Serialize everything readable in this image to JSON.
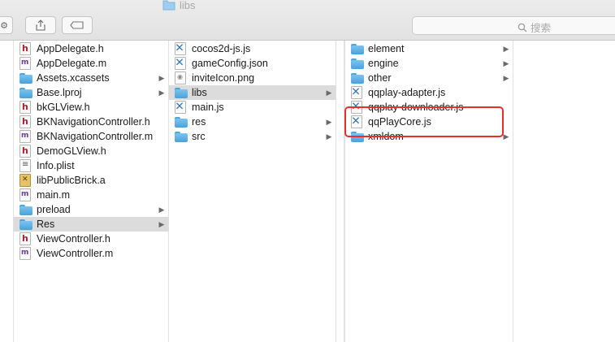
{
  "window": {
    "title": "libs"
  },
  "search": {
    "placeholder": "搜索"
  },
  "col1": [
    {
      "label": "AppDelegate.h",
      "icon": "h-file-icon",
      "folder": false,
      "selected": false
    },
    {
      "label": "AppDelegate.m",
      "icon": "m-file-icon",
      "folder": false,
      "selected": false
    },
    {
      "label": "Assets.xcassets",
      "icon": "folder-icon",
      "folder": true,
      "selected": false
    },
    {
      "label": "Base.lproj",
      "icon": "folder-icon",
      "folder": true,
      "selected": false
    },
    {
      "label": "bkGLView.h",
      "icon": "h-file-icon",
      "folder": false,
      "selected": false
    },
    {
      "label": "BKNavigationController.h",
      "icon": "h-file-icon",
      "folder": false,
      "selected": false
    },
    {
      "label": "BKNavigationController.m",
      "icon": "m-file-icon",
      "folder": false,
      "selected": false
    },
    {
      "label": "DemoGLView.h",
      "icon": "h-file-icon",
      "folder": false,
      "selected": false
    },
    {
      "label": "Info.plist",
      "icon": "plist-file-icon",
      "folder": false,
      "selected": false
    },
    {
      "label": "libPublicBrick.a",
      "icon": "archive-file-icon",
      "folder": false,
      "selected": false
    },
    {
      "label": "main.m",
      "icon": "m-file-icon",
      "folder": false,
      "selected": false
    },
    {
      "label": "preload",
      "icon": "folder-icon",
      "folder": true,
      "selected": false
    },
    {
      "label": "Res",
      "icon": "folder-icon",
      "folder": true,
      "selected": true
    },
    {
      "label": "ViewController.h",
      "icon": "h-file-icon",
      "folder": false,
      "selected": false
    },
    {
      "label": "ViewController.m",
      "icon": "m-file-icon",
      "folder": false,
      "selected": false
    }
  ],
  "col2": [
    {
      "label": "cocos2d-js.js",
      "icon": "js-file-icon",
      "folder": false,
      "selected": false
    },
    {
      "label": "gameConfig.json",
      "icon": "js-file-icon",
      "folder": false,
      "selected": false
    },
    {
      "label": "inviteIcon.png",
      "icon": "png-file-icon",
      "folder": false,
      "selected": false
    },
    {
      "label": "libs",
      "icon": "folder-icon",
      "folder": true,
      "selected": true
    },
    {
      "label": "main.js",
      "icon": "js-file-icon",
      "folder": false,
      "selected": false
    },
    {
      "label": "res",
      "icon": "folder-icon",
      "folder": true,
      "selected": false
    },
    {
      "label": "src",
      "icon": "folder-icon",
      "folder": true,
      "selected": false
    }
  ],
  "col4": [
    {
      "label": "element",
      "icon": "folder-icon",
      "folder": true,
      "selected": false
    },
    {
      "label": "engine",
      "icon": "folder-icon",
      "folder": true,
      "selected": false
    },
    {
      "label": "other",
      "icon": "folder-icon",
      "folder": true,
      "selected": false
    },
    {
      "label": "qqplay-adapter.js",
      "icon": "js-file-icon",
      "folder": false,
      "selected": false
    },
    {
      "label": "qqplay-downloader.js",
      "icon": "js-file-icon",
      "folder": false,
      "selected": false
    },
    {
      "label": "qqPlayCore.js",
      "icon": "js-file-icon",
      "folder": false,
      "selected": false
    },
    {
      "label": "xmldom",
      "icon": "folder-icon",
      "folder": true,
      "selected": false
    }
  ],
  "colors": {
    "highlight": "#e8302a",
    "selection": "#dcdcdc",
    "folder": "#4aa1da"
  }
}
